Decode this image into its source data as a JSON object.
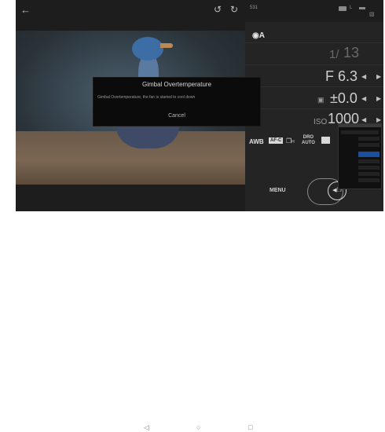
{
  "topbar": {
    "shots_remaining": "531",
    "battery_label": "L"
  },
  "panel": {
    "mode": "A",
    "shutter_prefix": "1/",
    "shutter_value": "13",
    "aperture": "F 6.3",
    "ev_value": "±0.0",
    "iso_label": "ISO",
    "iso_value": "1000",
    "wb": "AWB",
    "af_mode": "AF-C",
    "drive_mode": "H",
    "dro_line1": "DRO",
    "dro_line2": "AUTO",
    "menu_label": "MENU"
  },
  "dialog": {
    "title": "Gimbal Overtemperature",
    "message": "Gimbal Overtemperature,  the fan is started to cool down",
    "cancel_label": "Cancel"
  },
  "icons": {
    "back": "arrow-left-icon",
    "rotate_left": "rotate-ccw-icon",
    "rotate_right": "rotate-cw-icon",
    "sd_card": "sd-card-icon",
    "shutter": "shutter-release-icon"
  },
  "colors": {
    "app_bg": "#1d1d1d",
    "panel_bg": "#242424",
    "dialog_bg": "#0b0b0b",
    "accent_blue": "#1a4f9e"
  }
}
